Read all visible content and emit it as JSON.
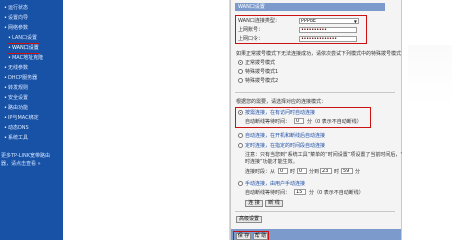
{
  "sidebar": {
    "items": [
      {
        "label": "运行状态"
      },
      {
        "label": "设置向导"
      },
      {
        "label": "网络参数"
      },
      {
        "label": "LAN口设置"
      },
      {
        "label": "WAN口设置"
      },
      {
        "label": "MAC地址克隆"
      },
      {
        "label": "无线参数"
      },
      {
        "label": "DHCP服务器"
      },
      {
        "label": "转发规则"
      },
      {
        "label": "安全设置"
      },
      {
        "label": "路由功能"
      },
      {
        "label": "IP与MAC绑定"
      },
      {
        "label": "动态DNS"
      },
      {
        "label": "系统工具"
      }
    ],
    "footer_line1": "更多TP-LINK宽带路由",
    "footer_line2": "器，请点击查看 »"
  },
  "panel": {
    "title": "WAN口设置",
    "wan_type_label": "WAN口连接类型：",
    "wan_type_value": "PPPoE",
    "account_label": "上网账号：",
    "account_value": "••••••••••",
    "password_label": "上网口令：",
    "password_value": "••••••••••••••",
    "special_dial_hint": "如果正常拨号模式下无法连接成功，请依次尝试下列模式中的特殊拨号模式：",
    "dial_mode_normal": "正常拨号模式",
    "dial_mode_special1": "特殊拨号模式1",
    "dial_mode_special2": "特殊拨号模式2",
    "connect_mode_hint": "根据您的需要，请选择对应的连接模式：",
    "on_demand_label": "按需连接，在有访问时自动连接",
    "auto_disconnect_label": "自动断线等待时间：",
    "auto_disconnect_value": "0",
    "auto_disconnect_unit": "分（0 表示不自动断线）",
    "auto_connect_label": "自动连接，在开机和断线后自动连接",
    "timed_connect_label": "定时连接，在指定的时间段自动连接",
    "timed_note_line1": "注意：只有当您到“系统工具”菜单的“时间设置”项设置了当前时间后，“定",
    "timed_note_line2": "时连接”功能才能生效。",
    "timed_period_label": "连接时段：从",
    "timed_from_hour": "0",
    "timed_hour_unit1": "时",
    "timed_from_min": "0",
    "timed_to_label": "分到",
    "timed_to_hour": "23",
    "timed_hour_unit2": "时",
    "timed_to_min": "59",
    "timed_min_unit": "分",
    "manual_connect_label": "手动连接，由用户手动连接",
    "manual_disconnect_label": "自动断线等待时间：",
    "manual_disconnect_value": "15",
    "manual_disconnect_unit": "分（0 表示不自动断线）",
    "connect_button": "连 接",
    "disconnect_button": "断 线",
    "advanced_button": "高级设置",
    "save_button": "保 存",
    "help_button": "帮 助"
  },
  "colors": {
    "sidebar_bg": "#1752a6",
    "title_bar": "#7c9bcc",
    "highlight_red": "#cc1111",
    "panel_bg": "#f4f4f4"
  }
}
